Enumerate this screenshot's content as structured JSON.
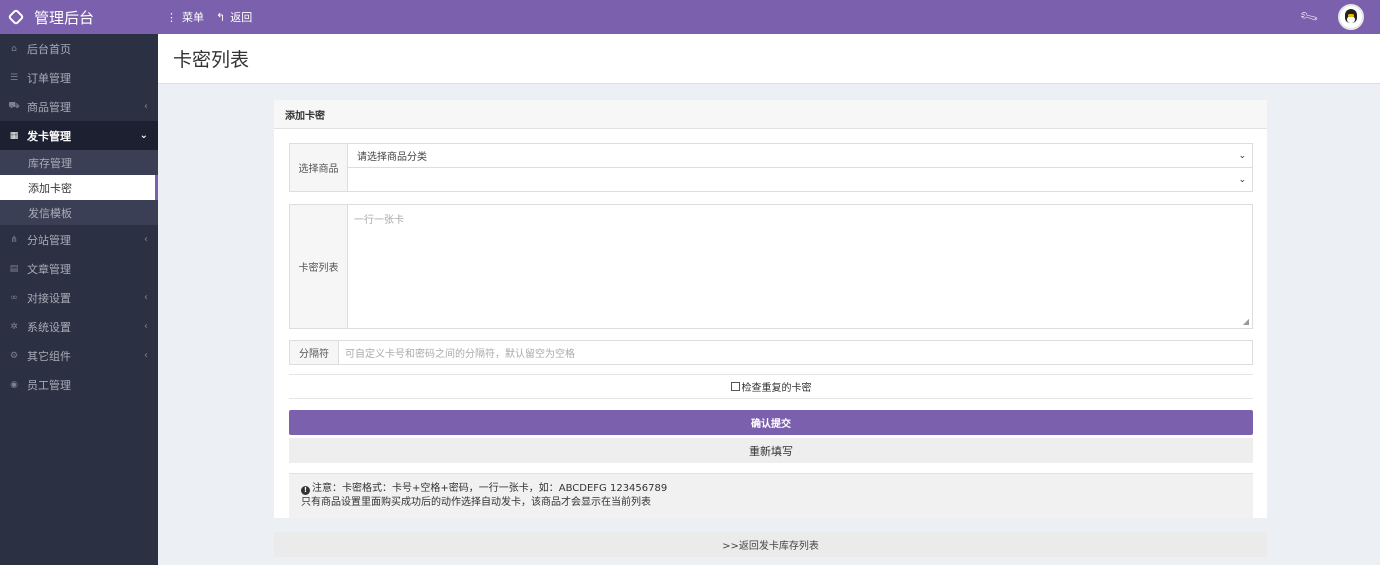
{
  "header": {
    "brand": "管理后台",
    "menu_label": "菜单",
    "back_label": "返回"
  },
  "sidebar": {
    "items": [
      {
        "label": "后台首页",
        "icon": "home-icon"
      },
      {
        "label": "订单管理",
        "icon": "list-icon"
      },
      {
        "label": "商品管理",
        "icon": "cart-icon",
        "has_chevron": true
      },
      {
        "label": "发卡管理",
        "icon": "grid-icon",
        "active": true,
        "expanded": true
      },
      {
        "label": "分站管理",
        "icon": "sitemap-icon",
        "has_chevron": true
      },
      {
        "label": "文章管理",
        "icon": "article-icon"
      },
      {
        "label": "对接设置",
        "icon": "link-icon",
        "has_chevron": true
      },
      {
        "label": "系统设置",
        "icon": "gear-icon",
        "has_chevron": true
      },
      {
        "label": "其它组件",
        "icon": "cogs-icon",
        "has_chevron": true
      },
      {
        "label": "员工管理",
        "icon": "user-icon"
      }
    ],
    "submenu": [
      {
        "label": "库存管理"
      },
      {
        "label": "添加卡密",
        "current": true
      },
      {
        "label": "发信模板"
      }
    ]
  },
  "page": {
    "title": "卡密列表"
  },
  "form": {
    "panel_title": "添加卡密",
    "product_label": "选择商品",
    "category_select": "请选择商品分类",
    "product_select": "",
    "cards_label": "卡密列表",
    "cards_placeholder": "一行一张卡",
    "separator_label": "分隔符",
    "separator_placeholder": "可自定义卡号和密码之间的分隔符，默认留空为空格",
    "check_dup_label": "检查重复的卡密",
    "check_dup_checked": false,
    "submit_label": "确认提交",
    "reset_label": "重新填写",
    "notice_line1": "注意：卡密格式：卡号+空格+密码，一行一张卡，如：ABCDEFG 123456789",
    "notice_line2": "只有商品设置里面购买成功后的动作选择自动发卡，该商品才会显示在当前列表"
  },
  "back_link": ">>返回发卡库存列表",
  "colors": {
    "accent": "#7b60ad",
    "sidebar_bg": "#2c3043"
  }
}
